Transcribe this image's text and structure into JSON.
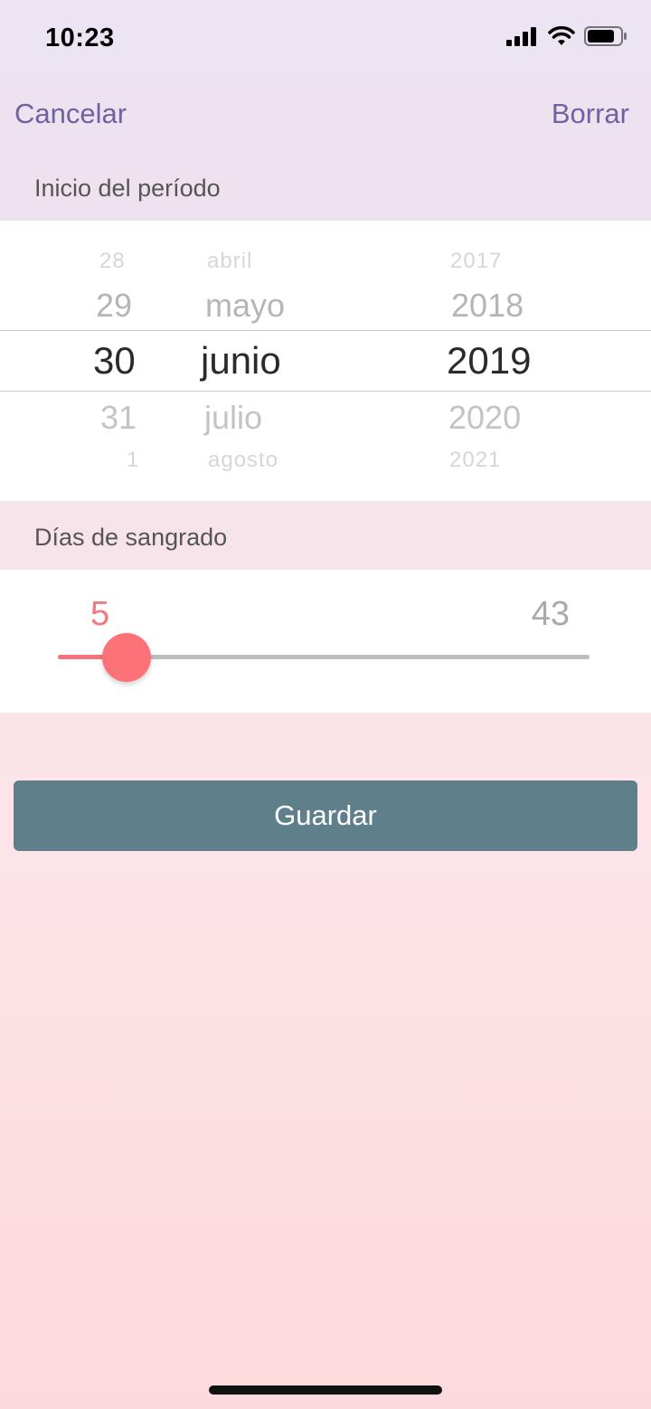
{
  "status_bar": {
    "time": "10:23",
    "icons": [
      "cellular-signal-icon",
      "wifi-icon",
      "battery-icon"
    ]
  },
  "nav": {
    "cancel_label": "Cancelar",
    "clear_label": "Borrar"
  },
  "period_start": {
    "label": "Inicio del período",
    "picker": {
      "days": [
        "28",
        "29",
        "30",
        "31",
        "1"
      ],
      "months": [
        "abril",
        "mayo",
        "junio",
        "julio",
        "agosto"
      ],
      "years": [
        "2017",
        "2018",
        "2019",
        "2020",
        "2021"
      ],
      "selected": {
        "day": "30",
        "month": "junio",
        "year": "2019"
      }
    }
  },
  "bleeding_days": {
    "label": "Días de sangrado",
    "value": "5",
    "max": "43",
    "fraction": 0.13
  },
  "save_label": "Guardar",
  "colors": {
    "accent_purple": "#6f62a3",
    "slider_pink": "#fd7179",
    "button_slate": "#5f7f8b"
  }
}
